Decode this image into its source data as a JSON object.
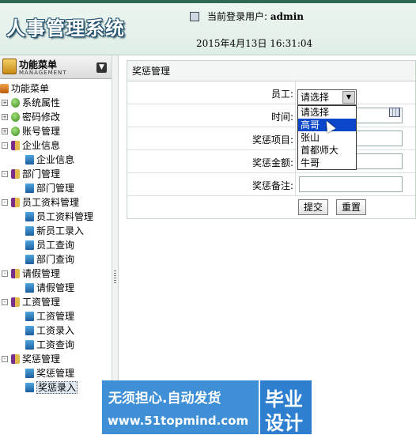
{
  "app": {
    "title": "人事管理系统"
  },
  "header": {
    "user_label": "当前登录用户:",
    "user_value": "admin",
    "datetime": "2015年4月13日  16:31:04"
  },
  "sidebar": {
    "title": "功能菜单",
    "subtitle": "MANAGEMENT",
    "collapse_icon": "chevron-down-icon",
    "root": "功能菜单",
    "items": [
      {
        "label": "系统属性"
      },
      {
        "label": "密码修改"
      },
      {
        "label": "账号管理"
      },
      {
        "label": "企业信息",
        "children": [
          "企业信息"
        ]
      },
      {
        "label": "部门管理",
        "children": [
          "部门管理"
        ]
      },
      {
        "label": "员工资料管理",
        "children": [
          "员工资料管理",
          "新员工录入",
          "员工查询",
          "部门查询"
        ]
      },
      {
        "label": "请假管理",
        "children": [
          "请假管理"
        ]
      },
      {
        "label": "工资管理",
        "children": [
          "工资管理",
          "工资录入",
          "工资查询"
        ]
      },
      {
        "label": "奖惩管理",
        "children": [
          "奖惩管理",
          "奖惩录入"
        ]
      }
    ]
  },
  "panel": {
    "title": "奖惩管理",
    "employee_label": "员工:",
    "time_label": "时间:",
    "item_label": "奖惩项目:",
    "amount_label": "奖惩金额:",
    "note_label": "奖惩备注:",
    "select": {
      "value": "请选择",
      "options": [
        "请选择",
        "高哥",
        "张山",
        "首都师大",
        "牛哥"
      ],
      "highlighted": "高哥"
    },
    "submit_label": "提交",
    "reset_label": "重置"
  },
  "watermark": {
    "line1": "无须担心.自动发货",
    "line2": "www.51topmind.com",
    "side1": "毕业",
    "side2": "设计"
  }
}
